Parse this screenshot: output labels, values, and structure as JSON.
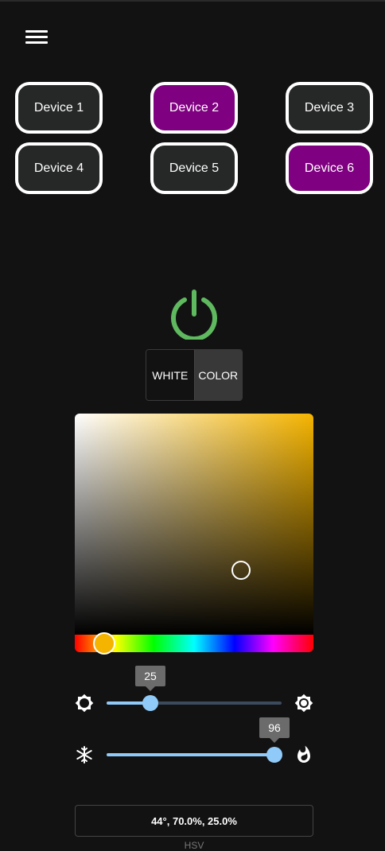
{
  "devices": [
    {
      "label": "Device 1",
      "active": false
    },
    {
      "label": "Device 2",
      "active": true
    },
    {
      "label": "Device 3",
      "active": false
    },
    {
      "label": "Device 4",
      "active": false
    },
    {
      "label": "Device 5",
      "active": false
    },
    {
      "label": "Device 6",
      "active": true
    }
  ],
  "mode": {
    "white_label": "WHITE",
    "color_label": "COLOR",
    "selected": "COLOR"
  },
  "color": {
    "hue": 44,
    "saturation": 0.7,
    "value": 0.25,
    "hex": "#f5b400"
  },
  "brightness": {
    "value": 25,
    "min": 0,
    "max": 100
  },
  "temperature": {
    "value": 96,
    "min": 0,
    "max": 100
  },
  "hsv_readout": {
    "value": "44°, 70.0%, 25.0%",
    "label": "HSV"
  },
  "colors": {
    "accent": "#90caf9",
    "device_active": "#7f0080",
    "power_on": "#5fb95f",
    "background": "#121212"
  }
}
